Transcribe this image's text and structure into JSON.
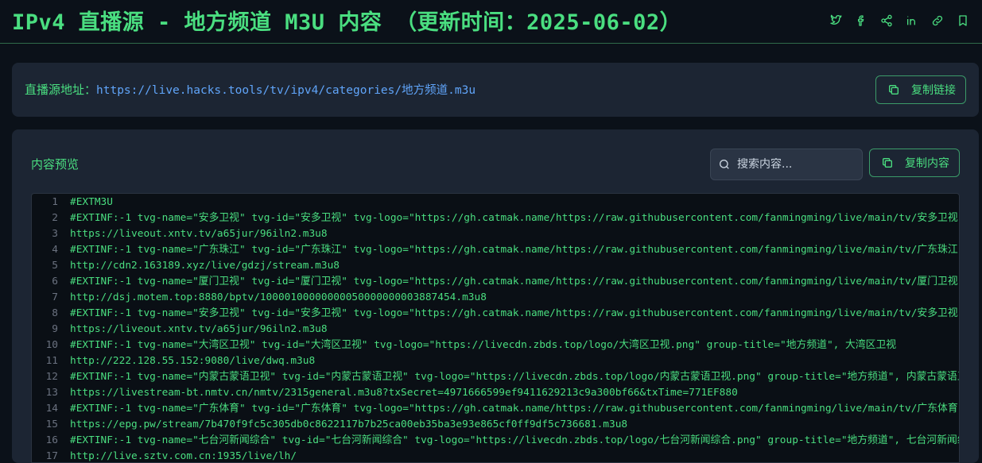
{
  "header": {
    "title": "IPv4 直播源 - 地方频道 M3U 内容 （更新时间：2025-06-02）"
  },
  "url_card": {
    "label": "直播源地址：",
    "url": "https://live.hacks.tools/tv/ipv4/categories/地方频道.m3u",
    "copy_link_label": "复制链接"
  },
  "content": {
    "preview_label": "内容预览",
    "search_placeholder": "搜索内容...",
    "copy_content_label": "复制内容",
    "lines": [
      {
        "n": "1",
        "text": "#EXTM3U"
      },
      {
        "n": "2",
        "text": "#EXTINF:-1 tvg-name=\"安多卫视\" tvg-id=\"安多卫视\" tvg-logo=\"https://gh.catmak.name/https://raw.githubusercontent.com/fanmingming/live/main/tv/安多卫视"
      },
      {
        "n": "3",
        "text": "https://liveout.xntv.tv/a65jur/96iln2.m3u8"
      },
      {
        "n": "4",
        "text": "#EXTINF:-1 tvg-name=\"广东珠江\" tvg-id=\"广东珠江\" tvg-logo=\"https://gh.catmak.name/https://raw.githubusercontent.com/fanmingming/live/main/tv/广东珠江"
      },
      {
        "n": "5",
        "text": "http://cdn2.163189.xyz/live/gdzj/stream.m3u8"
      },
      {
        "n": "6",
        "text": "#EXTINF:-1 tvg-name=\"厦门卫视\" tvg-id=\"厦门卫视\" tvg-logo=\"https://gh.catmak.name/https://raw.githubusercontent.com/fanmingming/live/main/tv/厦门卫视"
      },
      {
        "n": "7",
        "text": "http://dsj.motem.top:8880/bptv/10000100000000050000000003887454.m3u8"
      },
      {
        "n": "8",
        "text": "#EXTINF:-1 tvg-name=\"安多卫视\" tvg-id=\"安多卫视\" tvg-logo=\"https://gh.catmak.name/https://raw.githubusercontent.com/fanmingming/live/main/tv/安多卫视"
      },
      {
        "n": "9",
        "text": "https://liveout.xntv.tv/a65jur/96iln2.m3u8"
      },
      {
        "n": "10",
        "text": "#EXTINF:-1 tvg-name=\"大湾区卫视\" tvg-id=\"大湾区卫视\" tvg-logo=\"https://livecdn.zbds.top/logo/大湾区卫视.png\" group-title=\"地方频道\", 大湾区卫视"
      },
      {
        "n": "11",
        "text": "http://222.128.55.152:9080/live/dwq.m3u8"
      },
      {
        "n": "12",
        "text": "#EXTINF:-1 tvg-name=\"内蒙古蒙语卫视\" tvg-id=\"内蒙古蒙语卫视\" tvg-logo=\"https://livecdn.zbds.top/logo/内蒙古蒙语卫视.png\" group-title=\"地方频道\", 内蒙古蒙语卫视"
      },
      {
        "n": "13",
        "text": "https://livestream-bt.nmtv.cn/nmtv/2315general.m3u8?txSecret=4971666599ef9411629213c9a300bf66&txTime=771EF880"
      },
      {
        "n": "14",
        "text": "#EXTINF:-1 tvg-name=\"广东体育\" tvg-id=\"广东体育\" tvg-logo=\"https://gh.catmak.name/https://raw.githubusercontent.com/fanmingming/live/main/tv/广东体育"
      },
      {
        "n": "15",
        "text": "https://epg.pw/stream/7b470f9fc5c305db0c8622117b7b25ca00eb35ba3e93e865cf0ff9df5c736681.m3u8"
      },
      {
        "n": "16",
        "text": "#EXTINF:-1 tvg-name=\"七台河新闻综合\" tvg-id=\"七台河新闻综合\" tvg-logo=\"https://livecdn.zbds.top/logo/七台河新闻综合.png\" group-title=\"地方频道\", 七台河新闻综合"
      },
      {
        "n": "17",
        "text": "http://live.sztv.com.cn:1935/live/lh/"
      }
    ]
  },
  "colors": {
    "accent": "#4ade80",
    "link": "#60a5fa",
    "card_bg": "#1c2533",
    "page_bg": "#0b1119"
  },
  "share_icons": [
    "twitter-icon",
    "facebook-icon",
    "share-icon",
    "linkedin-icon",
    "link-icon",
    "bookmark-icon"
  ]
}
